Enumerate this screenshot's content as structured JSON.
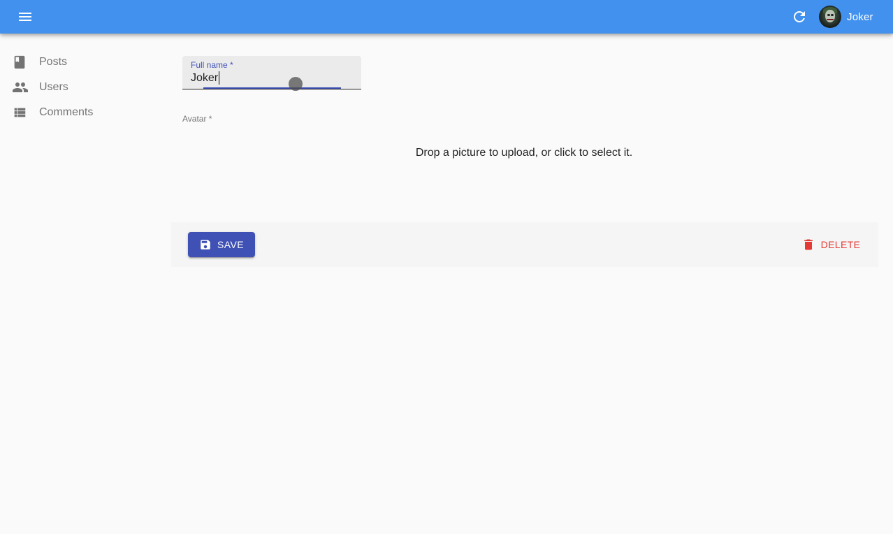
{
  "appbar": {
    "user_name": "Joker",
    "accent_color": "#4291ee"
  },
  "sidebar": {
    "items": [
      {
        "label": "Posts",
        "icon": "book-icon"
      },
      {
        "label": "Users",
        "icon": "people-icon"
      },
      {
        "label": "Comments",
        "icon": "list-icon"
      }
    ]
  },
  "form": {
    "full_name": {
      "label": "Full name *",
      "value": "Joker"
    },
    "avatar": {
      "label": "Avatar *",
      "dropzone_text": "Drop a picture to upload, or click to select it."
    }
  },
  "toolbar": {
    "save_label": "SAVE",
    "delete_label": "DELETE",
    "primary_color": "#3f51b5",
    "danger_color": "#e53935"
  }
}
